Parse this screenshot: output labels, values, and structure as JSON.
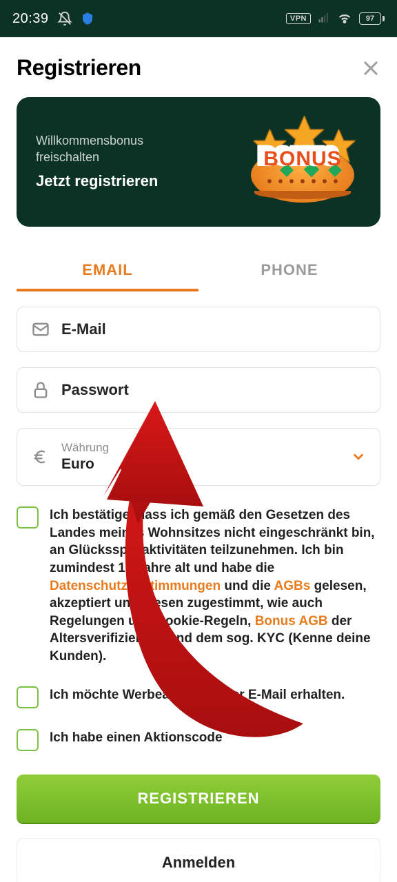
{
  "status": {
    "time": "20:39",
    "vpn": "VPN",
    "battery": "97"
  },
  "header": {
    "title": "Registrieren"
  },
  "banner": {
    "subtitle_line1": "Willkommensbonus",
    "subtitle_line2": "freischalten",
    "cta": "Jetzt registrieren",
    "bonus_label": "BONUS"
  },
  "tabs": {
    "email": "EMAIL",
    "phone": "PHONE"
  },
  "fields": {
    "email_placeholder": "E-Mail",
    "password_placeholder": "Passwort",
    "currency_label": "Währung",
    "currency_value": "Euro"
  },
  "checks": {
    "terms_pre": "Ich bestätige, dass ich gemäß den Gesetzen des Landes meines Wohnsitzes nicht eingeschränkt bin, an Glücksspielaktivitäten teilzunehmen. Ich bin zumindest 18 Jahre alt und habe die ",
    "terms_link1": "Datenschutzbestimmungen",
    "terms_mid1": " und die ",
    "terms_link2": "AGBs",
    "terms_mid2": " gelesen, akzeptiert und diesen zugestimmt, wie auch Regelungen und Cookie-Regeln, ",
    "terms_link3": "Bonus AGB",
    "terms_post": " der Altersverifizierung und dem sog. KYC (Kenne deine Kunden).",
    "marketing": "Ich möchte Werbeangebote per E-Mail erhalten.",
    "promo": "Ich habe einen Aktionscode"
  },
  "buttons": {
    "register": "REGISTRIEREN",
    "login": "Anmelden"
  }
}
